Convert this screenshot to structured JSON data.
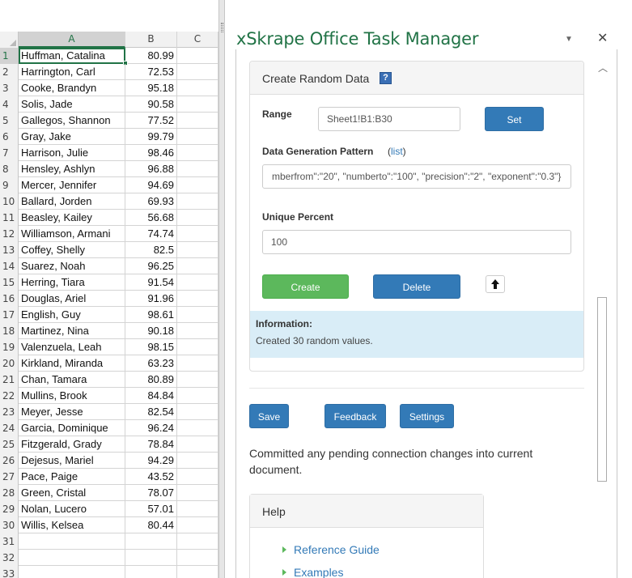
{
  "sheet": {
    "columns": [
      "A",
      "B",
      "C"
    ],
    "rows": [
      {
        "n": "1",
        "name": "Huffman, Catalina",
        "value": "80.99"
      },
      {
        "n": "2",
        "name": "Harrington, Carl",
        "value": "72.53"
      },
      {
        "n": "3",
        "name": "Cooke, Brandyn",
        "value": "95.18"
      },
      {
        "n": "4",
        "name": "Solis, Jade",
        "value": "90.58"
      },
      {
        "n": "5",
        "name": "Gallegos, Shannon",
        "value": "77.52"
      },
      {
        "n": "6",
        "name": "Gray, Jake",
        "value": "99.79"
      },
      {
        "n": "7",
        "name": "Harrison, Julie",
        "value": "98.46"
      },
      {
        "n": "8",
        "name": "Hensley, Ashlyn",
        "value": "96.88"
      },
      {
        "n": "9",
        "name": "Mercer, Jennifer",
        "value": "94.69"
      },
      {
        "n": "10",
        "name": "Ballard, Jorden",
        "value": "69.93"
      },
      {
        "n": "11",
        "name": "Beasley, Kailey",
        "value": "56.68"
      },
      {
        "n": "12",
        "name": "Williamson, Armani",
        "value": "74.74"
      },
      {
        "n": "13",
        "name": "Coffey, Shelly",
        "value": "82.5"
      },
      {
        "n": "14",
        "name": "Suarez, Noah",
        "value": "96.25"
      },
      {
        "n": "15",
        "name": "Herring, Tiara",
        "value": "91.54"
      },
      {
        "n": "16",
        "name": "Douglas, Ariel",
        "value": "91.96"
      },
      {
        "n": "17",
        "name": "English, Guy",
        "value": "98.61"
      },
      {
        "n": "18",
        "name": "Martinez, Nina",
        "value": "90.18"
      },
      {
        "n": "19",
        "name": "Valenzuela, Leah",
        "value": "98.15"
      },
      {
        "n": "20",
        "name": "Kirkland, Miranda",
        "value": "63.23"
      },
      {
        "n": "21",
        "name": "Chan, Tamara",
        "value": "80.89"
      },
      {
        "n": "22",
        "name": "Mullins, Brook",
        "value": "84.84"
      },
      {
        "n": "23",
        "name": "Meyer, Jesse",
        "value": "82.54"
      },
      {
        "n": "24",
        "name": "Garcia, Dominique",
        "value": "96.24"
      },
      {
        "n": "25",
        "name": "Fitzgerald, Grady",
        "value": "78.84"
      },
      {
        "n": "26",
        "name": "Dejesus, Mariel",
        "value": "94.29"
      },
      {
        "n": "27",
        "name": "Pace, Paige",
        "value": "43.52"
      },
      {
        "n": "28",
        "name": "Green, Cristal",
        "value": "78.07"
      },
      {
        "n": "29",
        "name": "Nolan, Lucero",
        "value": "57.01"
      },
      {
        "n": "30",
        "name": "Willis, Kelsea",
        "value": "80.44"
      },
      {
        "n": "31",
        "name": "",
        "value": ""
      },
      {
        "n": "32",
        "name": "",
        "value": ""
      },
      {
        "n": "33",
        "name": "",
        "value": ""
      }
    ]
  },
  "pane": {
    "title": "xSkrape Office Task Manager",
    "menu_icon": "▼",
    "close_icon": "✕",
    "random_data": {
      "title": "Create Random Data",
      "help_icon": "?",
      "range_label": "Range",
      "range_value": "Sheet1!B1:B30",
      "set_label": "Set",
      "pattern_label": "Data Generation Pattern",
      "list_label": "list",
      "pattern_value": "mberfrom\":\"20\", \"numberto\":\"100\", \"precision\":\"2\", \"exponent\":\"0.3\"}",
      "unique_label": "Unique Percent",
      "unique_value": "100",
      "create_label": "Create",
      "delete_label": "Delete",
      "info_title": "Information:",
      "info_text": "Created 30 random values."
    },
    "save_label": "Save",
    "feedback_label": "Feedback",
    "settings_label": "Settings",
    "status_message": "Committed any pending connection changes into current document.",
    "help": {
      "title": "Help",
      "links": [
        "Reference Guide",
        "Examples"
      ]
    }
  }
}
